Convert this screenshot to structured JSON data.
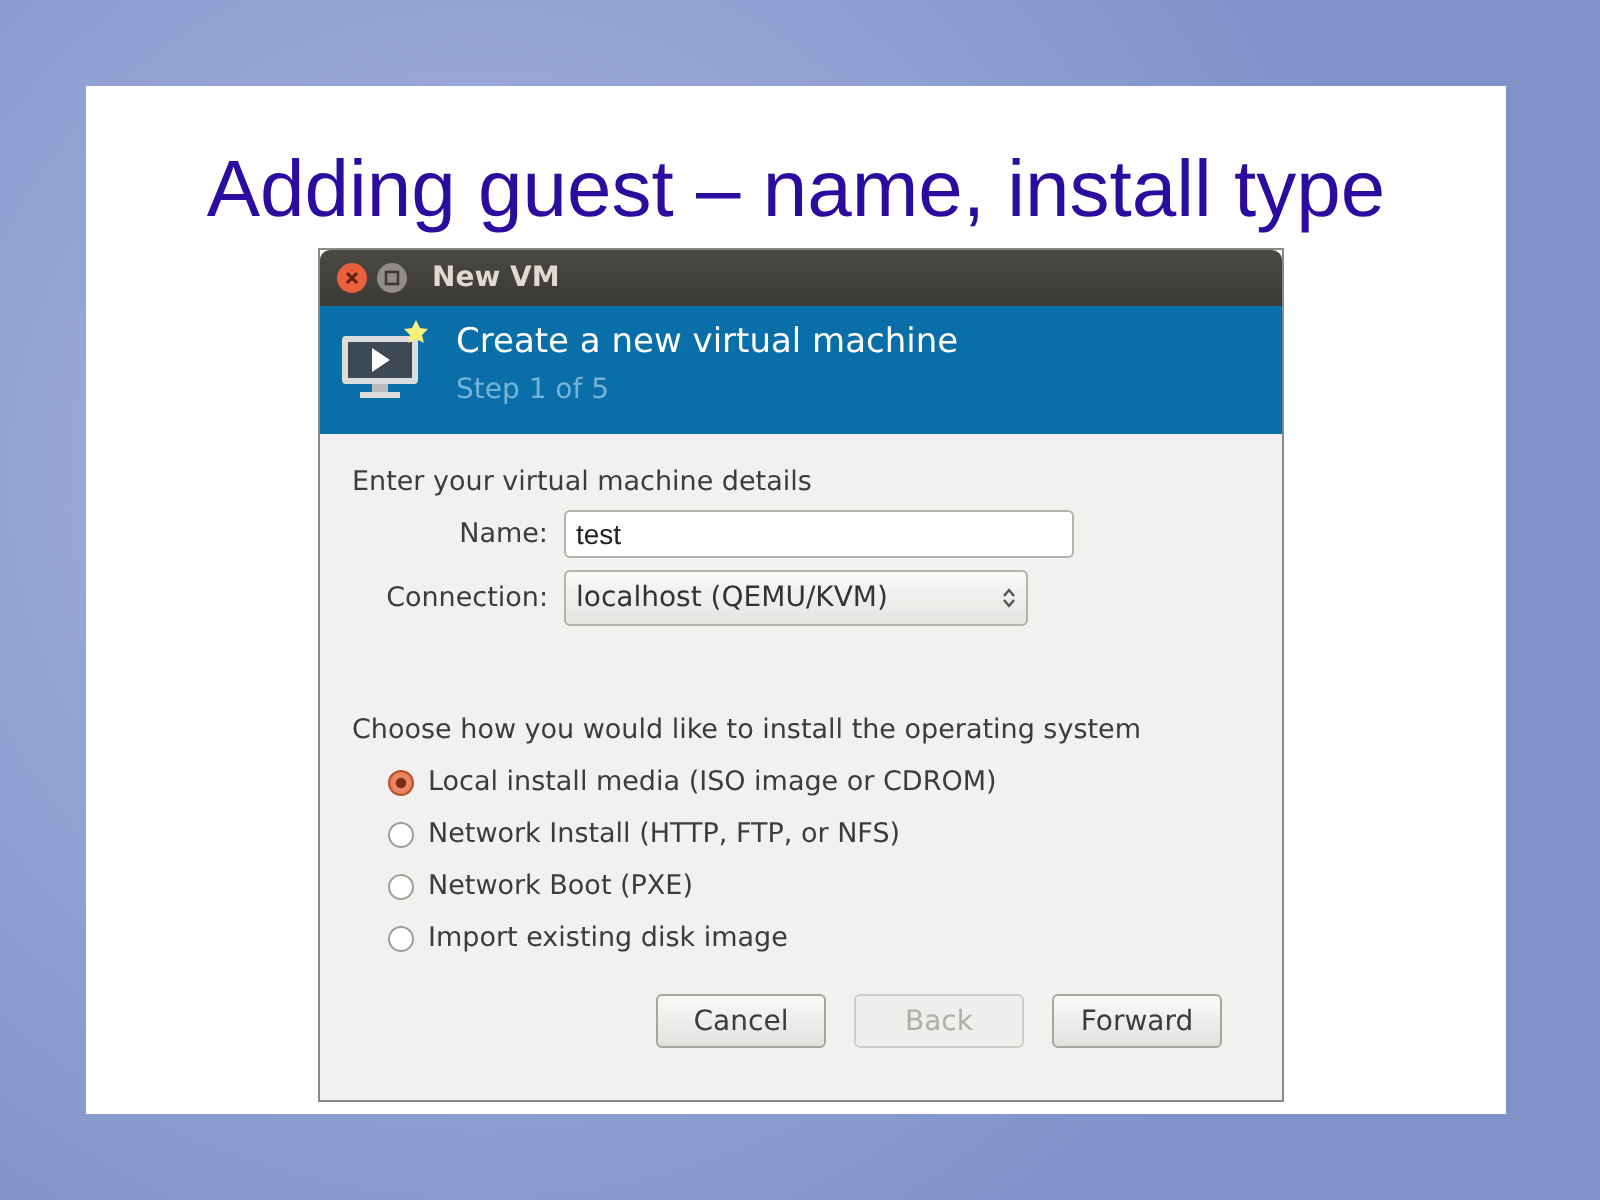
{
  "slide": {
    "title": "Adding guest – name, install type"
  },
  "window": {
    "title": "New VM"
  },
  "header": {
    "title": "Create a new virtual machine",
    "subtitle": "Step 1 of 5"
  },
  "details": {
    "heading": "Enter your virtual machine details",
    "name": {
      "label": "Name:",
      "value": "test"
    },
    "connection": {
      "label": "Connection:",
      "value": "localhost (QEMU/KVM)"
    }
  },
  "install": {
    "heading": "Choose how you would like to install the operating system",
    "options": [
      {
        "label": "Local install media (ISO image or CDROM)",
        "selected": true
      },
      {
        "label": "Network Install (HTTP, FTP, or NFS)",
        "selected": false
      },
      {
        "label": "Network Boot (PXE)",
        "selected": false
      },
      {
        "label": "Import existing disk image",
        "selected": false
      }
    ]
  },
  "buttons": [
    {
      "label": "Cancel",
      "disabled": false
    },
    {
      "label": "Back",
      "disabled": true
    },
    {
      "label": "Forward",
      "disabled": false
    }
  ]
}
